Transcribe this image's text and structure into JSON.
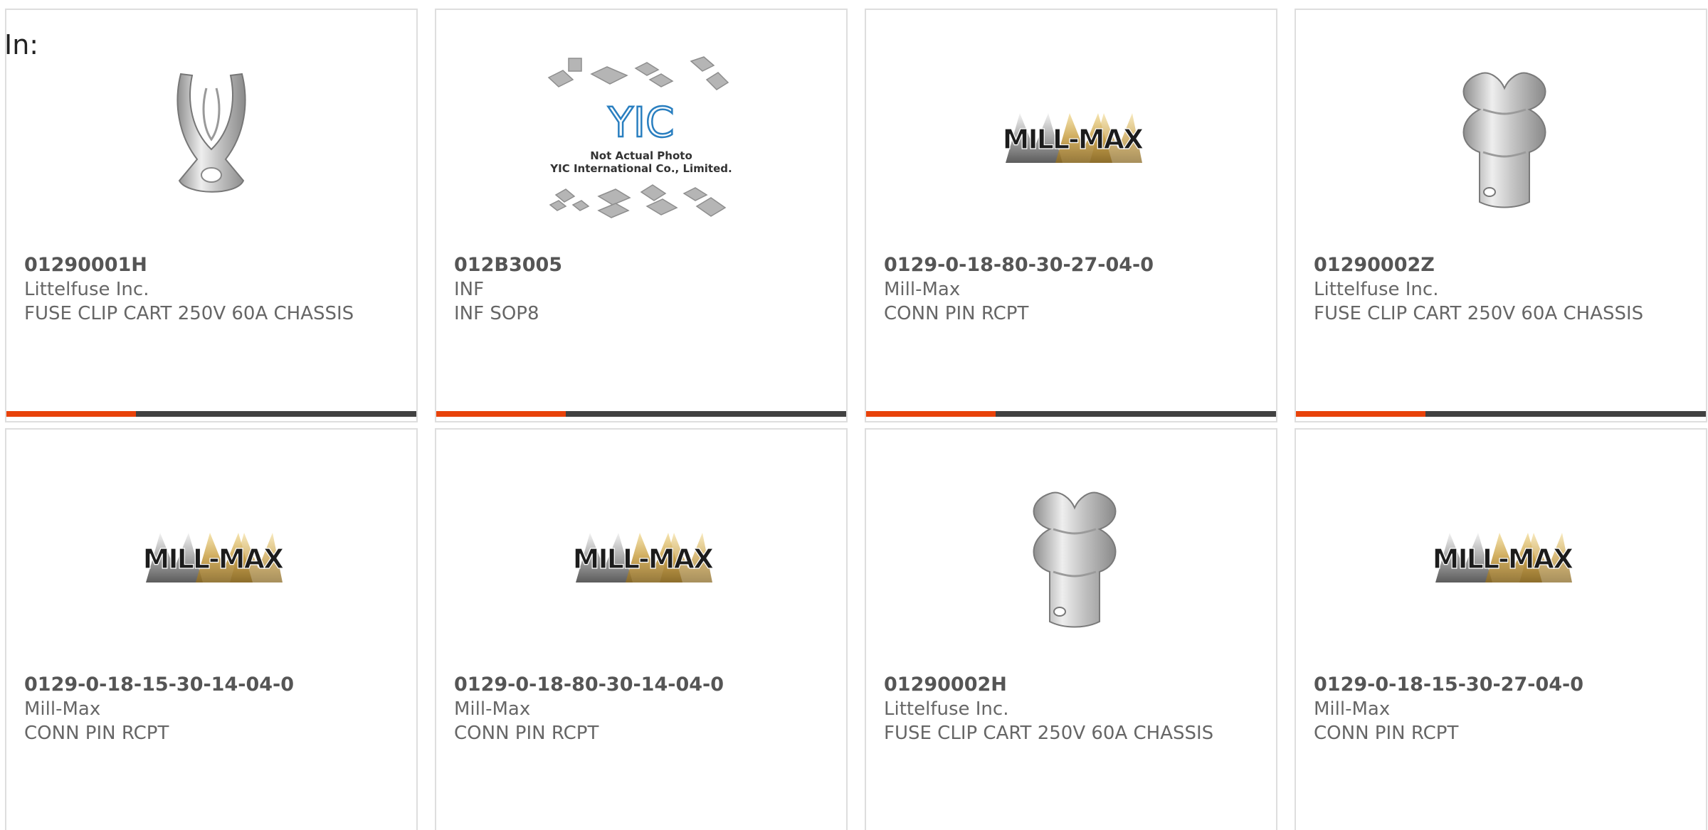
{
  "filter_label": "In:",
  "colors": {
    "accent": "#e8420a",
    "bar": "#414141",
    "text": "#666666",
    "title": "#555555",
    "yic_blue": "#2a7fc0"
  },
  "cards": [
    {
      "part_number": "01290001H",
      "manufacturer": "Littelfuse Inc.",
      "description": "FUSE CLIP CART 250V 60A CHASSIS",
      "image_icon": "fuse-clip-open-icon"
    },
    {
      "part_number": "012B3005",
      "manufacturer": "INF",
      "description": "INF SOP8",
      "image_icon": "yic-placeholder-image",
      "placeholder_logo": "YIC",
      "placeholder_line1": "Not Actual Photo",
      "placeholder_line2": "YIC International Co., Limited."
    },
    {
      "part_number": "0129-0-18-80-30-27-04-0",
      "manufacturer": "Mill-Max",
      "description": "CONN PIN RCPT",
      "image_icon": "mill-max-logo",
      "logo_text": "MILL-MAX"
    },
    {
      "part_number": "01290002Z",
      "manufacturer": "Littelfuse Inc.",
      "description": "FUSE CLIP CART 250V 60A CHASSIS",
      "image_icon": "fuse-clip-icon"
    },
    {
      "part_number": "0129-0-18-15-30-14-04-0",
      "manufacturer": "Mill-Max",
      "description": "CONN PIN RCPT",
      "image_icon": "mill-max-logo",
      "logo_text": "MILL-MAX"
    },
    {
      "part_number": "0129-0-18-80-30-14-04-0",
      "manufacturer": "Mill-Max",
      "description": "CONN PIN RCPT",
      "image_icon": "mill-max-logo",
      "logo_text": "MILL-MAX"
    },
    {
      "part_number": "01290002H",
      "manufacturer": "Littelfuse Inc.",
      "description": "FUSE CLIP CART 250V 60A CHASSIS",
      "image_icon": "fuse-clip-icon"
    },
    {
      "part_number": "0129-0-18-15-30-27-04-0",
      "manufacturer": "Mill-Max",
      "description": "CONN PIN RCPT",
      "image_icon": "mill-max-logo",
      "logo_text": "MILL-MAX"
    }
  ]
}
